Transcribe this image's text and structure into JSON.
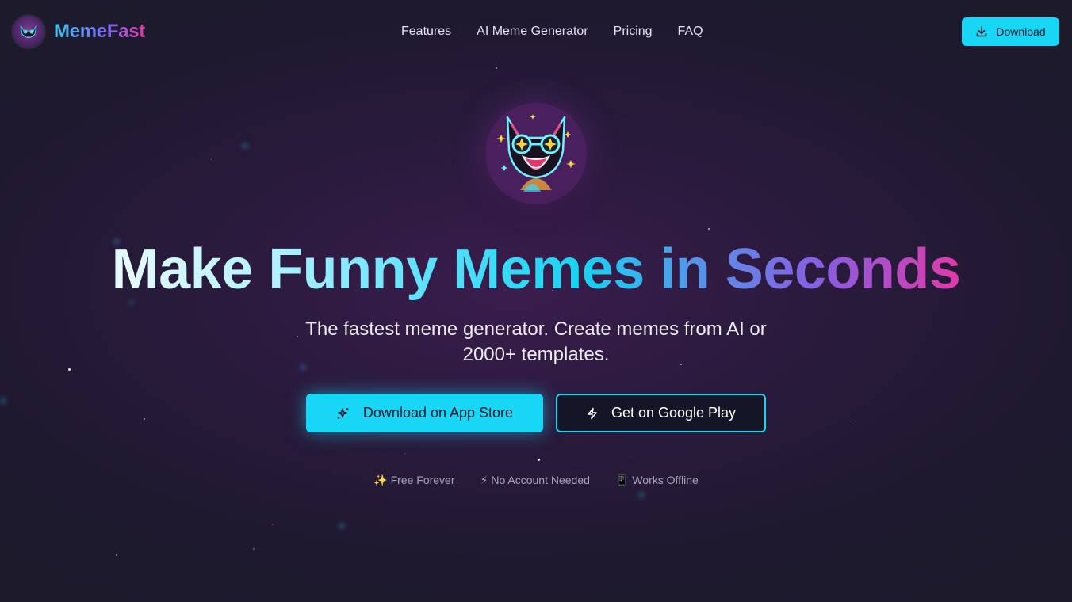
{
  "brand": {
    "name": "MemeFast",
    "logo_icon": "cat-mascot-icon"
  },
  "nav": {
    "links": [
      "Features",
      "AI Meme Generator",
      "Pricing",
      "FAQ"
    ],
    "download_label": "Download"
  },
  "hero": {
    "logo_icon": "cat-mascot-icon",
    "headline": "Make Funny Memes in Seconds",
    "subtitle": "The fastest meme generator. Create memes from AI or 2000+ templates.",
    "primary_button": "Download on App Store",
    "secondary_button": "Get on Google Play"
  },
  "features": [
    {
      "icon": "✨",
      "label": "Free Forever"
    },
    {
      "icon": "⚡",
      "label": "No Account Needed"
    },
    {
      "icon": "📱",
      "label": "Works Offline"
    }
  ],
  "colors": {
    "accent": "#18d6f5",
    "brand_gradient_start": "#3cc7f0",
    "brand_gradient_end": "#e03aa8",
    "background": "#2a1a3d"
  }
}
